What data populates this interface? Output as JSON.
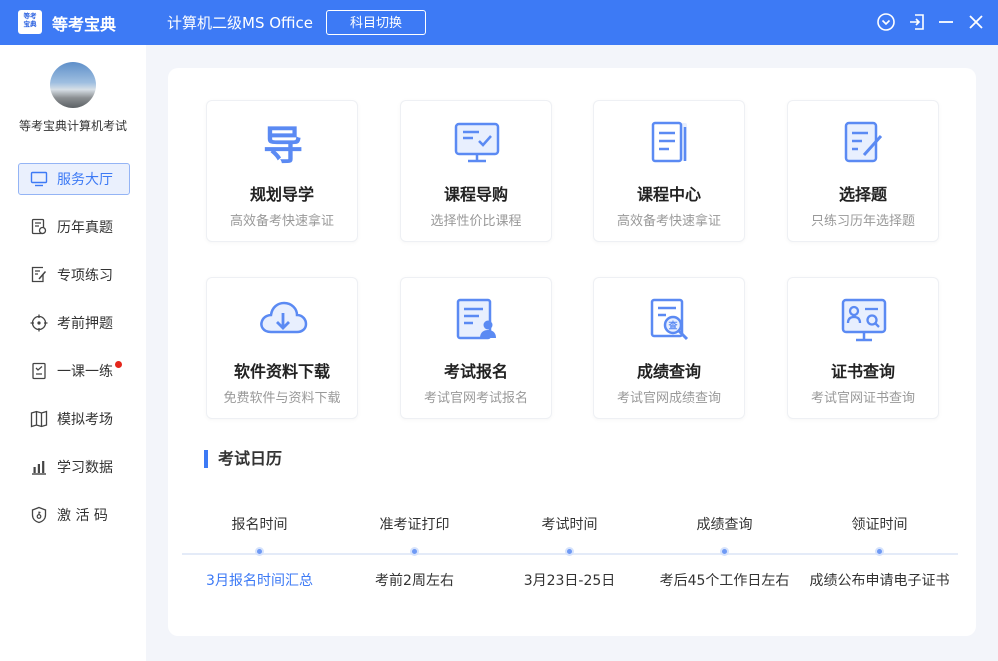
{
  "titlebar": {
    "logo_text": [
      "等考",
      "宝典"
    ],
    "app_name": "等考宝典",
    "subject": "计算机二级MS Office",
    "switch_label": "科目切换"
  },
  "sidebar": {
    "username": "等考宝典计算机考试",
    "items": [
      {
        "label": "服务大厅",
        "icon": "monitor-icon",
        "active": true
      },
      {
        "label": "历年真题",
        "icon": "exam-paper-icon"
      },
      {
        "label": "专项练习",
        "icon": "edit-doc-icon"
      },
      {
        "label": "考前押题",
        "icon": "target-icon"
      },
      {
        "label": "一课一练",
        "icon": "checklist-icon",
        "badge": true
      },
      {
        "label": "模拟考场",
        "icon": "book-icon"
      },
      {
        "label": "学习数据",
        "icon": "bar-chart-icon"
      },
      {
        "label": "激 活 码",
        "icon": "shield-key-icon"
      }
    ]
  },
  "cards": [
    {
      "title": "规划导学",
      "subtitle": "高效备考快速拿证",
      "icon": "dao-icon",
      "icon_text": "导"
    },
    {
      "title": "课程导购",
      "subtitle": "选择性价比课程",
      "icon": "course-screen-icon"
    },
    {
      "title": "课程中心",
      "subtitle": "高效备考快速拿证",
      "icon": "document-list-icon"
    },
    {
      "title": "选择题",
      "subtitle": "只练习历年选择题",
      "icon": "edit-doc-icon"
    },
    {
      "title": "软件资料下载",
      "subtitle": "免费软件与资料下载",
      "icon": "cloud-download-icon"
    },
    {
      "title": "考试报名",
      "subtitle": "考试官网考试报名",
      "icon": "register-icon"
    },
    {
      "title": "成绩查询",
      "subtitle": "考试官网成绩查询",
      "icon": "score-search-icon",
      "icon_text": "查"
    },
    {
      "title": "证书查询",
      "subtitle": "考试官网证书查询",
      "icon": "certificate-search-icon"
    }
  ],
  "calendar": {
    "title": "考试日历",
    "items": [
      {
        "label": "报名时间",
        "value": "3月报名时间汇总",
        "link": true
      },
      {
        "label": "准考证打印",
        "value": "考前2周左右"
      },
      {
        "label": "考试时间",
        "value": "3月23日-25日"
      },
      {
        "label": "成绩查询",
        "value": "考后45个工作日左右"
      },
      {
        "label": "领证时间",
        "value": "成绩公布申请电子证书"
      }
    ]
  },
  "colors": {
    "accent": "#3d7af5",
    "badge": "#e5261b"
  }
}
